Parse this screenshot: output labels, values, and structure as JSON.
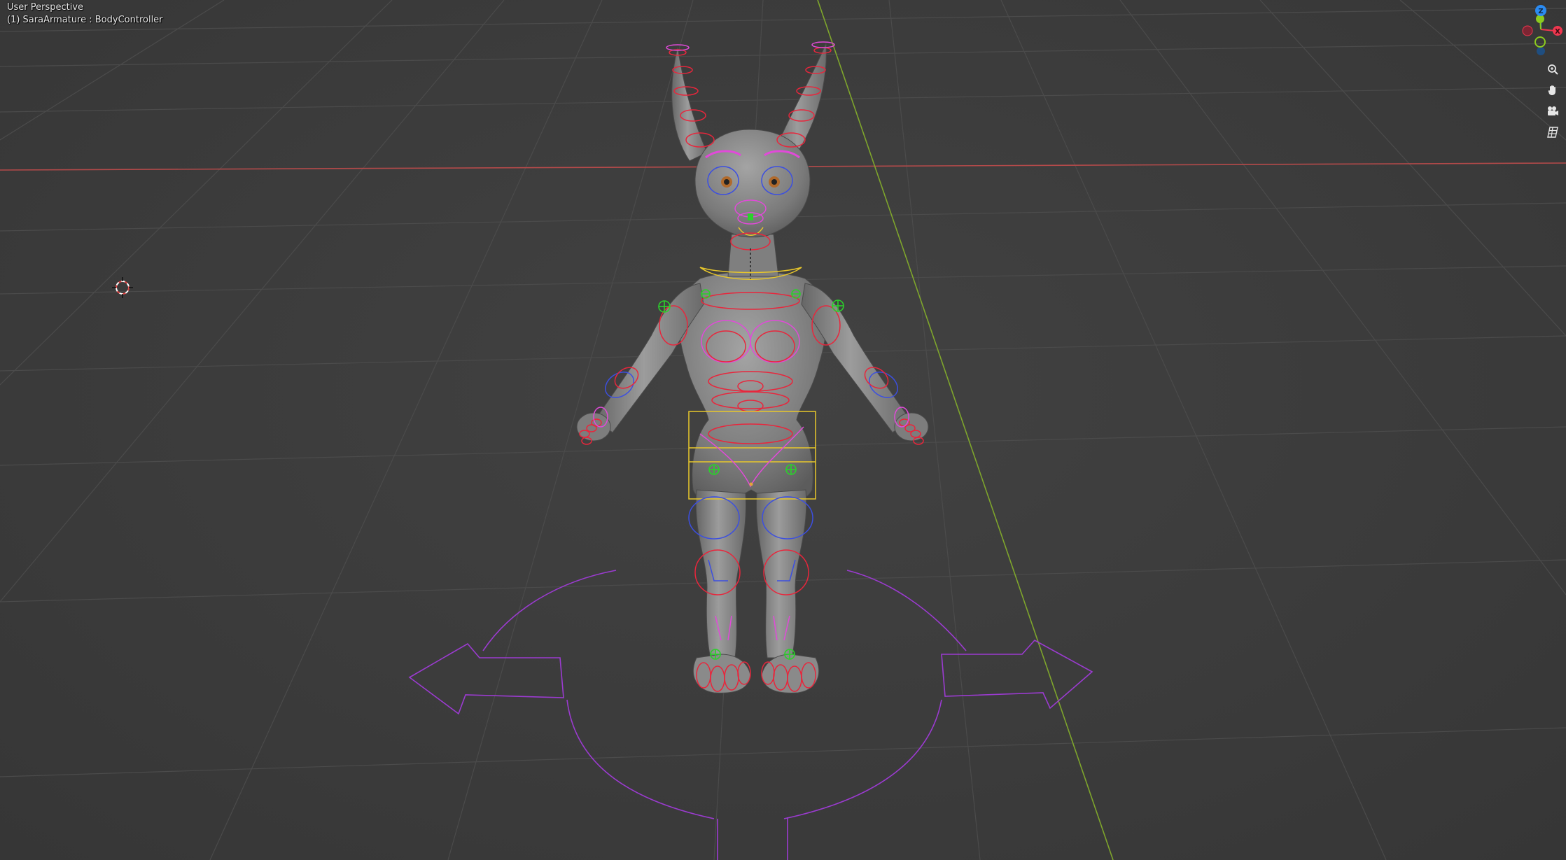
{
  "viewport": {
    "view_title": "User Perspective",
    "object_info": "(1) SaraArmature : BodyController"
  },
  "gizmo": {
    "axes": [
      {
        "name": "Z",
        "color": "#2b8bf2",
        "positive": true
      },
      {
        "name": "Y",
        "color": "#8ccb1f",
        "positive": true
      },
      {
        "name": "X",
        "color": "#f0374f",
        "positive": true
      }
    ]
  },
  "nav_tools": [
    {
      "icon": "zoom-icon"
    },
    {
      "icon": "hand-pan-icon"
    },
    {
      "icon": "camera-icon"
    },
    {
      "icon": "grid-ortho-icon"
    }
  ],
  "colors": {
    "background": "#3d3d3d",
    "grid": "#4e4e4e",
    "x_axis": "#b44a4a",
    "y_axis": "#7ea52c",
    "bone_red": "#e8263c",
    "bone_magenta": "#e14ad9",
    "bone_blue": "#3c4fe0",
    "bone_green": "#2bd12b",
    "bone_yellow": "#e8c72b",
    "root_purple": "#9b3bd0"
  }
}
